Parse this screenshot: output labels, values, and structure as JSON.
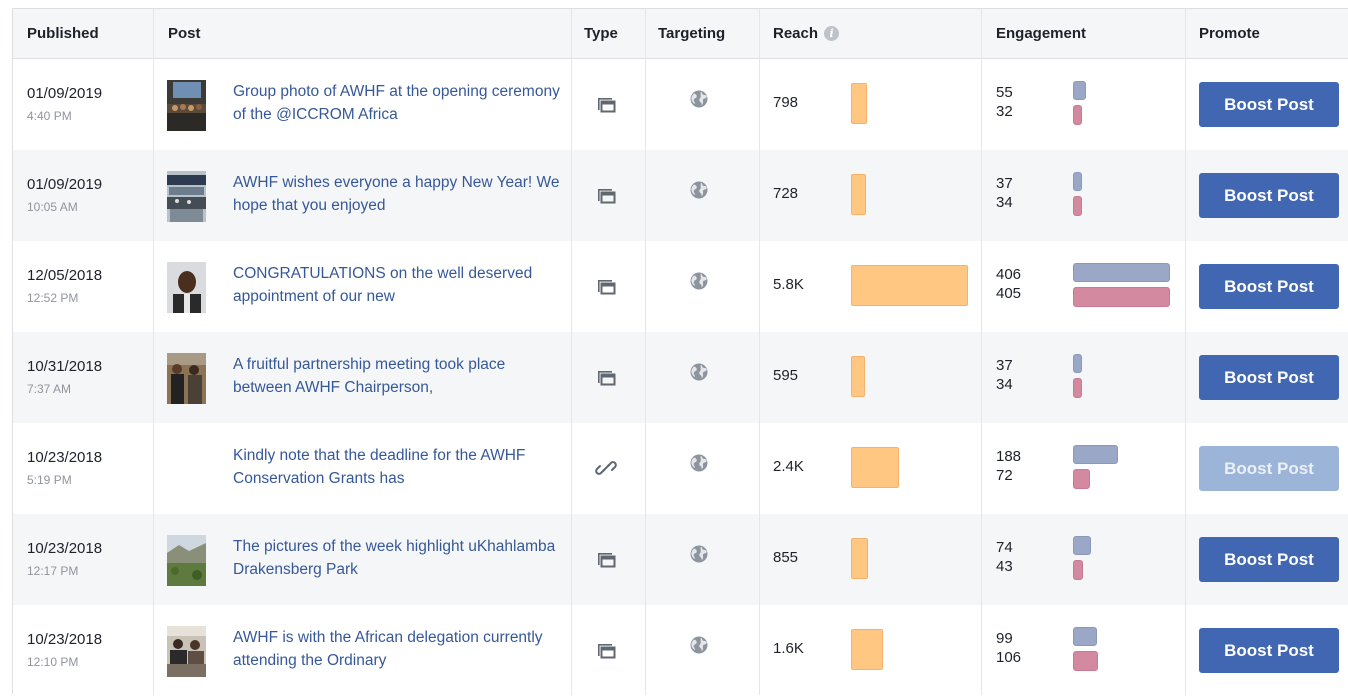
{
  "header": {
    "published": "Published",
    "post": "Post",
    "type": "Type",
    "targeting": "Targeting",
    "reach": "Reach",
    "engagement": "Engagement",
    "promote": "Promote"
  },
  "colors": {
    "link": "#365899",
    "reach_bar": "#ffc782",
    "engagement_bar_1": "#9aa7c7",
    "engagement_bar_2": "#d38aa0",
    "boost_button": "#4267b2",
    "boost_button_disabled": "#9cb4d8"
  },
  "posts": [
    {
      "date": "01/09/2019",
      "time": "4:40 PM",
      "text": "Group photo of AWHF at the opening ceremony of the @ICCROM Africa",
      "type_icon": "photo-icon",
      "targeting_icon": "globe-icon",
      "reach": "798",
      "reach_value": 798,
      "eng1": "55",
      "eng2": "32",
      "boost": "Boost Post",
      "boost_disabled": false,
      "thumb": "group-photo"
    },
    {
      "date": "01/09/2019",
      "time": "10:05 AM",
      "text": "AWHF wishes everyone a happy New Year! We hope that you enjoyed",
      "type_icon": "photo-icon",
      "targeting_icon": "globe-icon",
      "reach": "728",
      "reach_value": 728,
      "eng1": "37",
      "eng2": "34",
      "boost": "Boost Post",
      "boost_disabled": false,
      "thumb": "new-year"
    },
    {
      "date": "12/05/2018",
      "time": "12:52 PM",
      "text": "CONGRATULATIONS on the well deserved appointment of our new",
      "type_icon": "photo-icon",
      "targeting_icon": "globe-icon",
      "reach": "5.8K",
      "reach_value": 5800,
      "eng1": "406",
      "eng2": "405",
      "boost": "Boost Post",
      "boost_disabled": false,
      "thumb": "portrait"
    },
    {
      "date": "10/31/2018",
      "time": "7:37 AM",
      "text": "A fruitful partnership meeting took place between AWHF Chairperson,",
      "type_icon": "photo-icon",
      "targeting_icon": "globe-icon",
      "reach": "595",
      "reach_value": 595,
      "eng1": "37",
      "eng2": "34",
      "boost": "Boost Post",
      "boost_disabled": false,
      "thumb": "meeting"
    },
    {
      "date": "10/23/2018",
      "time": "5:19 PM",
      "text": "Kindly note that the deadline for the AWHF Conservation Grants has",
      "type_icon": "link-icon",
      "targeting_icon": "globe-icon",
      "reach": "2.4K",
      "reach_value": 2400,
      "eng1": "188",
      "eng2": "72",
      "boost": "Boost Post",
      "boost_disabled": true,
      "thumb": ""
    },
    {
      "date": "10/23/2018",
      "time": "12:17 PM",
      "text": "The pictures of the week highlight uKhahlamba Drakensberg Park",
      "type_icon": "photo-icon",
      "targeting_icon": "globe-icon",
      "reach": "855",
      "reach_value": 855,
      "eng1": "74",
      "eng2": "43",
      "boost": "Boost Post",
      "boost_disabled": false,
      "thumb": "landscape"
    },
    {
      "date": "10/23/2018",
      "time": "12:10 PM",
      "text": "AWHF is with the African delegation currently attending the Ordinary",
      "type_icon": "photo-icon",
      "targeting_icon": "globe-icon",
      "reach": "1.6K",
      "reach_value": 1600,
      "eng1": "99",
      "eng2": "106",
      "boost": "Boost Post",
      "boost_disabled": false,
      "thumb": "delegation"
    }
  ]
}
